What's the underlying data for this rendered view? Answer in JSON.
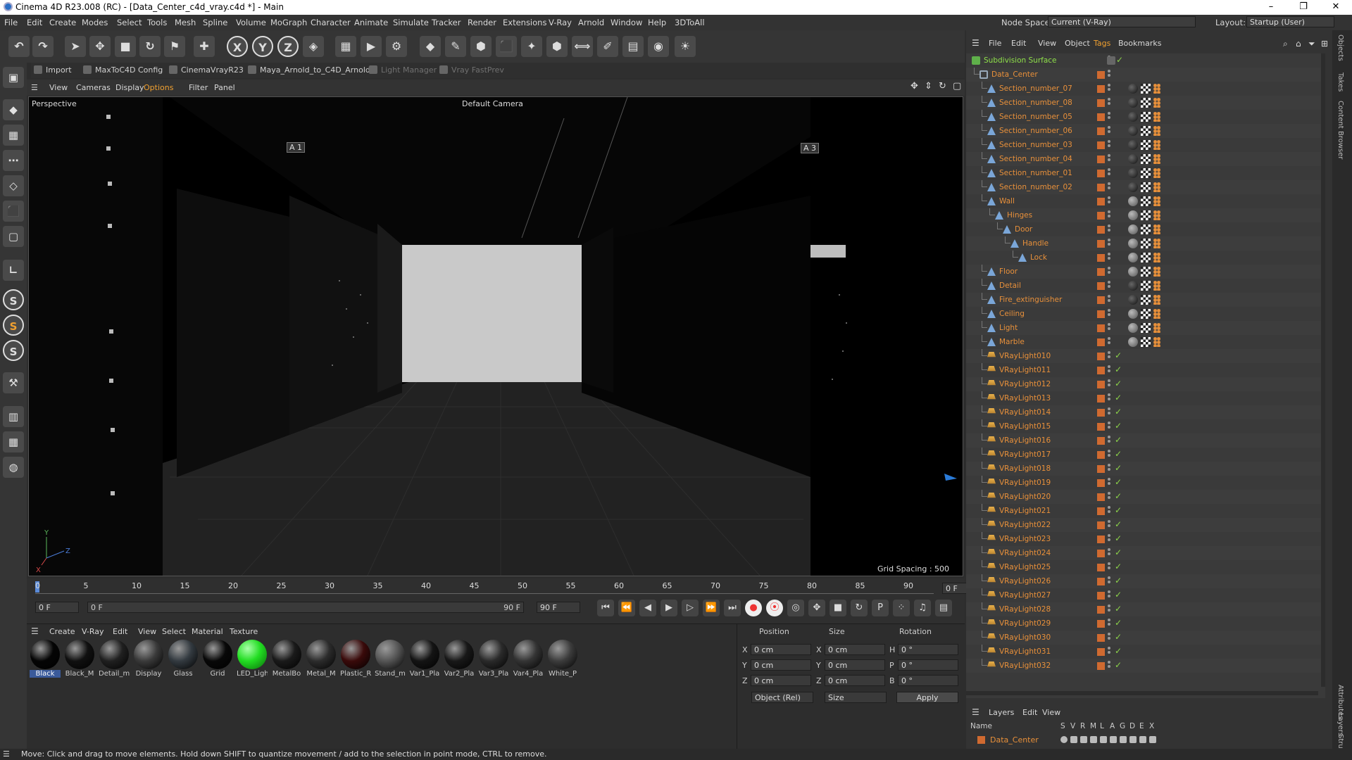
{
  "window": {
    "title": "Cinema 4D R23.008 (RC) - [Data_Center_c4d_vray.c4d *] - Main"
  },
  "window_controls": [
    "–",
    "❐",
    "✕"
  ],
  "menubar": {
    "items": [
      "File",
      "Edit",
      "Create",
      "Modes",
      "Select",
      "Tools",
      "Mesh",
      "Spline",
      "Volume",
      "MoGraph",
      "Character",
      "Animate",
      "Simulate",
      "Tracker",
      "Render",
      "Extensions",
      "V-Ray",
      "Arnold",
      "Window",
      "Help",
      "3DToAll"
    ],
    "node_space_label": "Node Space:",
    "node_space_value": "Current (V-Ray)",
    "layout_label": "Layout:",
    "layout_value": "Startup (User)"
  },
  "toolbar": {
    "axis": [
      "X",
      "Y",
      "Z"
    ]
  },
  "plugin_bar": {
    "items": [
      {
        "label": "Import",
        "dim": false
      },
      {
        "label": "MaxToC4D Config",
        "dim": false
      },
      {
        "label": "CinemaVrayR23",
        "dim": false
      },
      {
        "label": "Maya_Arnold_to_C4D_Arnold",
        "dim": false
      },
      {
        "label": "Light Manager",
        "dim": true
      },
      {
        "label": "Vray FastPrev",
        "dim": true
      }
    ]
  },
  "left_tools": [
    "S",
    "S",
    "S"
  ],
  "viewport_menu": {
    "items": [
      "View",
      "Cameras",
      "Display",
      "Options",
      "Filter",
      "Panel"
    ]
  },
  "viewport": {
    "view_name": "Perspective",
    "camera": "Default Camera",
    "grid_spacing": "Grid Spacing : 500 cm",
    "markers": [
      "A 1",
      "A 3"
    ],
    "axis_labels": [
      "Y",
      "Z",
      "X"
    ]
  },
  "timeline": {
    "ticks": [
      "0",
      "5",
      "10",
      "15",
      "20",
      "25",
      "30",
      "35",
      "40",
      "45",
      "50",
      "55",
      "60",
      "65",
      "70",
      "75",
      "80",
      "85",
      "90"
    ],
    "current_frame": "0 F",
    "start_field": "0 F",
    "range_start": "0 F",
    "range_end": "90 F",
    "end_field": "90 F"
  },
  "materials": {
    "menu": [
      "Create",
      "V-Ray",
      "Edit",
      "View",
      "Select",
      "Material",
      "Texture"
    ],
    "items": [
      {
        "name": "Black",
        "color": "#050505"
      },
      {
        "name": "Black_M",
        "color": "#101010"
      },
      {
        "name": "Detail_m",
        "color": "#202020"
      },
      {
        "name": "Display",
        "color": "#3a3a3a"
      },
      {
        "name": "Glass",
        "color": "#333a40"
      },
      {
        "name": "Grid",
        "color": "#080808"
      },
      {
        "name": "LED_Ligh",
        "color": "#22dd22"
      },
      {
        "name": "MetalBo",
        "color": "#1a1a1a"
      },
      {
        "name": "Metal_M",
        "color": "#2c2c2c"
      },
      {
        "name": "Plastic_R",
        "color": "#3a0a0a"
      },
      {
        "name": "Stand_m",
        "color": "#555555"
      },
      {
        "name": "Var1_Pla",
        "color": "#141414"
      },
      {
        "name": "Var2_Pla",
        "color": "#181818"
      },
      {
        "name": "Var3_Pla",
        "color": "#2a2a2a"
      },
      {
        "name": "Var4_Pla",
        "color": "#343434"
      },
      {
        "name": "White_P",
        "color": "#3c3c3c"
      }
    ]
  },
  "coordinates": {
    "headers": [
      "Position",
      "Size",
      "Rotation"
    ],
    "rows": [
      {
        "axis": "X",
        "pos": "0 cm",
        "size_axis": "X",
        "size": "0 cm",
        "rot_axis": "H",
        "rot": "0 °"
      },
      {
        "axis": "Y",
        "pos": "0 cm",
        "size_axis": "Y",
        "size": "0 cm",
        "rot_axis": "P",
        "rot": "0 °"
      },
      {
        "axis": "Z",
        "pos": "0 cm",
        "size_axis": "Z",
        "size": "0 cm",
        "rot_axis": "B",
        "rot": "0 °"
      }
    ],
    "mode": "Object (Rel)",
    "size_mode": "Size",
    "apply": "Apply"
  },
  "object_manager": {
    "menu": [
      "File",
      "Edit",
      "View",
      "Object",
      "Tags",
      "Bookmarks"
    ],
    "objects": [
      {
        "name": "Subdivision Surface",
        "indent": 0,
        "green": true,
        "kind": "sub",
        "tags": 0
      },
      {
        "name": "Data_Center",
        "indent": 1,
        "kind": "null",
        "tags": 0
      },
      {
        "name": "Section_number_07",
        "indent": 2,
        "kind": "poly",
        "tags": 3,
        "dark": true
      },
      {
        "name": "Section_number_08",
        "indent": 2,
        "kind": "poly",
        "tags": 3,
        "dark": true
      },
      {
        "name": "Section_number_05",
        "indent": 2,
        "kind": "poly",
        "tags": 3,
        "dark": true
      },
      {
        "name": "Section_number_06",
        "indent": 2,
        "kind": "poly",
        "tags": 3,
        "dark": true
      },
      {
        "name": "Section_number_03",
        "indent": 2,
        "kind": "poly",
        "tags": 3,
        "dark": true
      },
      {
        "name": "Section_number_04",
        "indent": 2,
        "kind": "poly",
        "tags": 3,
        "dark": true
      },
      {
        "name": "Section_number_01",
        "indent": 2,
        "kind": "poly",
        "tags": 3,
        "dark": true
      },
      {
        "name": "Section_number_02",
        "indent": 2,
        "kind": "poly",
        "tags": 3,
        "dark": true
      },
      {
        "name": "Wall",
        "indent": 2,
        "kind": "poly",
        "tags": 3
      },
      {
        "name": "Hinges",
        "indent": 3,
        "kind": "poly",
        "tags": 3
      },
      {
        "name": "Door",
        "indent": 4,
        "kind": "poly",
        "tags": 3
      },
      {
        "name": "Handle",
        "indent": 5,
        "kind": "poly",
        "tags": 3
      },
      {
        "name": "Lock",
        "indent": 6,
        "kind": "poly",
        "tags": 3
      },
      {
        "name": "Floor",
        "indent": 2,
        "kind": "poly",
        "tags": 3
      },
      {
        "name": "Detail",
        "indent": 2,
        "kind": "poly",
        "tags": 3,
        "dark": true
      },
      {
        "name": "Fire_extinguisher",
        "indent": 2,
        "kind": "poly",
        "tags": 3,
        "dark": true
      },
      {
        "name": "Ceiling",
        "indent": 2,
        "kind": "poly",
        "tags": 3
      },
      {
        "name": "Light",
        "indent": 2,
        "kind": "poly",
        "tags": 3
      },
      {
        "name": "Marble",
        "indent": 2,
        "kind": "poly",
        "tags": 3
      },
      {
        "name": "VRayLight010",
        "indent": 2,
        "kind": "light",
        "tags": 0,
        "check": true
      },
      {
        "name": "VRayLight011",
        "indent": 2,
        "kind": "light",
        "tags": 0,
        "check": true
      },
      {
        "name": "VRayLight012",
        "indent": 2,
        "kind": "light",
        "tags": 0,
        "check": true
      },
      {
        "name": "VRayLight013",
        "indent": 2,
        "kind": "light",
        "tags": 0,
        "check": true
      },
      {
        "name": "VRayLight014",
        "indent": 2,
        "kind": "light",
        "tags": 0,
        "check": true
      },
      {
        "name": "VRayLight015",
        "indent": 2,
        "kind": "light",
        "tags": 0,
        "check": true
      },
      {
        "name": "VRayLight016",
        "indent": 2,
        "kind": "light",
        "tags": 0,
        "check": true
      },
      {
        "name": "VRayLight017",
        "indent": 2,
        "kind": "light",
        "tags": 0,
        "check": true
      },
      {
        "name": "VRayLight018",
        "indent": 2,
        "kind": "light",
        "tags": 0,
        "check": true
      },
      {
        "name": "VRayLight019",
        "indent": 2,
        "kind": "light",
        "tags": 0,
        "check": true
      },
      {
        "name": "VRayLight020",
        "indent": 2,
        "kind": "light",
        "tags": 0,
        "check": true
      },
      {
        "name": "VRayLight021",
        "indent": 2,
        "kind": "light",
        "tags": 0,
        "check": true
      },
      {
        "name": "VRayLight022",
        "indent": 2,
        "kind": "light",
        "tags": 0,
        "check": true
      },
      {
        "name": "VRayLight023",
        "indent": 2,
        "kind": "light",
        "tags": 0,
        "check": true
      },
      {
        "name": "VRayLight024",
        "indent": 2,
        "kind": "light",
        "tags": 0,
        "check": true
      },
      {
        "name": "VRayLight025",
        "indent": 2,
        "kind": "light",
        "tags": 0,
        "check": true
      },
      {
        "name": "VRayLight026",
        "indent": 2,
        "kind": "light",
        "tags": 0,
        "check": true
      },
      {
        "name": "VRayLight027",
        "indent": 2,
        "kind": "light",
        "tags": 0,
        "check": true
      },
      {
        "name": "VRayLight028",
        "indent": 2,
        "kind": "light",
        "tags": 0,
        "check": true
      },
      {
        "name": "VRayLight029",
        "indent": 2,
        "kind": "light",
        "tags": 0,
        "check": true
      },
      {
        "name": "VRayLight030",
        "indent": 2,
        "kind": "light",
        "tags": 0,
        "check": true
      },
      {
        "name": "VRayLight031",
        "indent": 2,
        "kind": "light",
        "tags": 0,
        "check": true
      },
      {
        "name": "VRayLight032",
        "indent": 2,
        "kind": "light",
        "tags": 0,
        "check": true
      }
    ]
  },
  "layers": {
    "menu": [
      "Layers",
      "Edit",
      "View"
    ],
    "columns": [
      "Name",
      "S",
      "V",
      "R",
      "M",
      "L",
      "A",
      "G",
      "D",
      "E",
      "X"
    ],
    "items": [
      {
        "name": "Data_Center"
      }
    ]
  },
  "side_tabs": [
    "Objects",
    "Takes",
    "Content Browser",
    "Attributes",
    "Layers",
    "Struct"
  ],
  "status": {
    "text": "Move: Click and drag to move elements. Hold down SHIFT to quantize movement / add to the selection in point mode, CTRL to remove."
  },
  "colors": {
    "accent_orange": "#e8903a",
    "object_green": "#8fe04a",
    "led_green": "#22dd22"
  }
}
